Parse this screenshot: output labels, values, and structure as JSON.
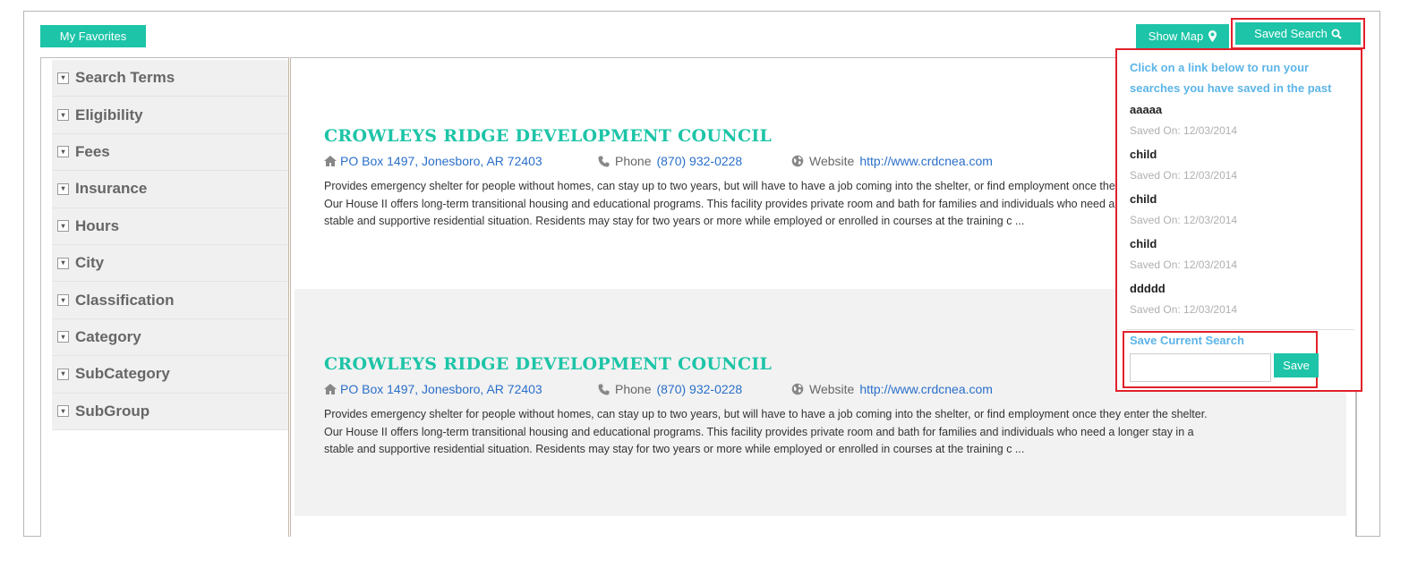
{
  "toolbar": {
    "favorites_label": "My Favorites",
    "show_map_label": "Show Map",
    "saved_search_label": "Saved Search"
  },
  "sidebar": {
    "items": [
      {
        "label": "Search Terms"
      },
      {
        "label": "Eligibility"
      },
      {
        "label": "Fees"
      },
      {
        "label": "Insurance"
      },
      {
        "label": "Hours"
      },
      {
        "label": "City"
      },
      {
        "label": "Classification"
      },
      {
        "label": "Category"
      },
      {
        "label": "SubCategory"
      },
      {
        "label": "SubGroup"
      }
    ]
  },
  "results": [
    {
      "title": "CROWLEYS RIDGE DEVELOPMENT COUNCIL",
      "address": "PO Box 1497,  Jonesboro,  AR  72403",
      "phone_label": "Phone",
      "phone": "(870) 932-0228",
      "website_label": "Website",
      "website": "http://www.crdcnea.com",
      "description": "Provides emergency shelter for people without homes, can stay up to two years, but will have to have a job coming into the shelter, or find employment once they enter the shelter. Our House II offers long-term transitional housing and educational programs. This facility provides private room and bath for families and individuals who need a longer stay in a stable and supportive residential situation. Residents may stay for two years or more while employed or enrolled in courses at the training c ..."
    },
    {
      "title": "CROWLEYS RIDGE DEVELOPMENT COUNCIL",
      "address": "PO Box 1497,  Jonesboro,  AR  72403",
      "phone_label": "Phone",
      "phone": "(870) 932-0228",
      "website_label": "Website",
      "website": "http://www.crdcnea.com",
      "description": "Provides emergency shelter for people without homes, can stay up to two years, but will have to have a job coming into the shelter, or find employment once they enter the shelter. Our House II offers long-term transitional housing and educational programs. This facility provides private room and bath for families and individuals who need a longer stay in a stable and supportive residential situation. Residents may stay for two years or more while employed or enrolled in courses at the training c ..."
    }
  ],
  "saved_search": {
    "heading": "Click on a link below to run your searches you have saved in the past",
    "items": [
      {
        "name": "aaaaa",
        "saved_on": "Saved On: 12/03/2014"
      },
      {
        "name": "child",
        "saved_on": "Saved On: 12/03/2014"
      },
      {
        "name": "child",
        "saved_on": "Saved On: 12/03/2014"
      },
      {
        "name": "child",
        "saved_on": "Saved On: 12/03/2014"
      },
      {
        "name": "ddddd",
        "saved_on": "Saved On: 12/03/2014"
      }
    ],
    "save_current_label": "Save Current Search",
    "input_value": "",
    "save_button_label": "Save"
  },
  "colors": {
    "accent": "#1dc4a7",
    "link": "#2a6fc9",
    "highlight": "#e1212b",
    "dropdown_text": "#5cb5e8"
  }
}
